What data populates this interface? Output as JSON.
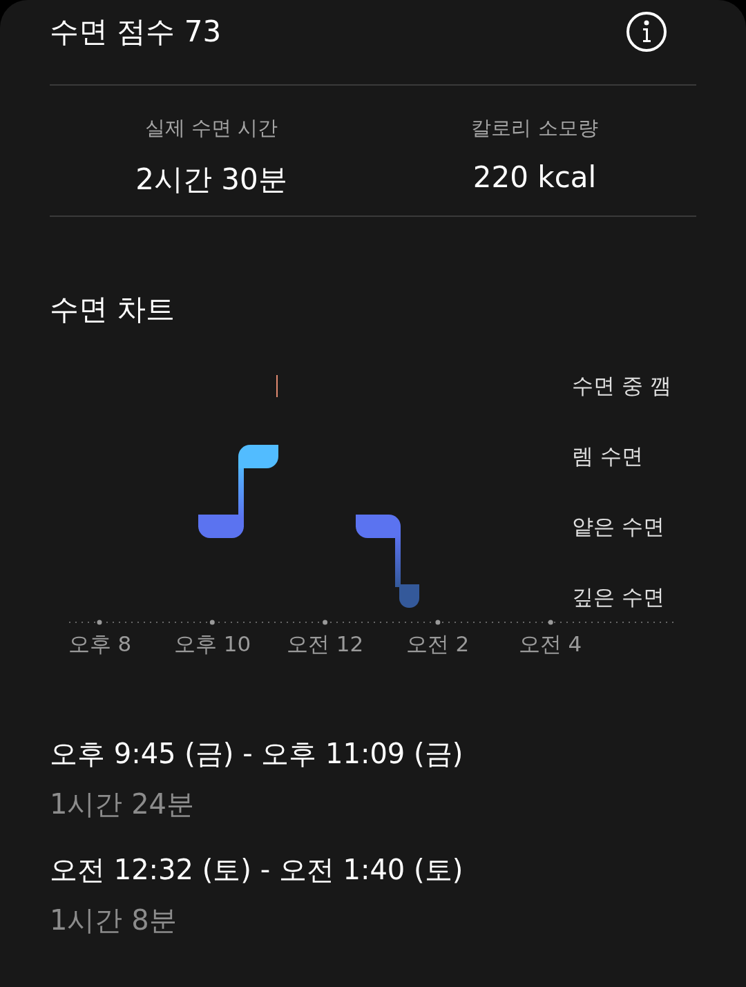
{
  "header": {
    "title": "수면 점수 73"
  },
  "stats": [
    {
      "label": "실제 수면 시간",
      "value": "2시간 30분"
    },
    {
      "label": "칼로리 소모량",
      "value": "220 kcal"
    }
  ],
  "chart": {
    "title": "수면 차트",
    "stages": [
      "수면 중 깸",
      "렘 수면",
      "얕은 수면",
      "깊은 수면"
    ],
    "time_labels": [
      "오후 8",
      "오후 10",
      "오전 12",
      "오전 2",
      "오전 4"
    ]
  },
  "sessions": [
    {
      "time": "오후 9:45 (금) - 오후 11:09 (금)",
      "duration": "1시간 24분"
    },
    {
      "time": "오전 12:32 (토) - 오전 1:40 (토)",
      "duration": "1시간 8분"
    }
  ]
}
